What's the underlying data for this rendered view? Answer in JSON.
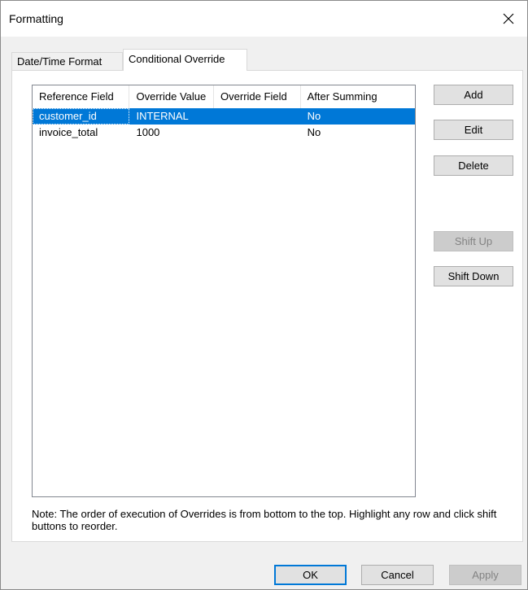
{
  "window": {
    "title": "Formatting"
  },
  "tabs": [
    {
      "label": "Date/Time Format",
      "active": false
    },
    {
      "label": "Conditional Override",
      "active": true
    }
  ],
  "table": {
    "columns": [
      "Reference Field",
      "Override Value",
      "Override Field",
      "After Summing"
    ],
    "rows": [
      {
        "reference_field": "customer_id",
        "override_value": "INTERNAL",
        "override_field": "",
        "after_summing": "No",
        "selected": true
      },
      {
        "reference_field": "invoice_total",
        "override_value": "1000",
        "override_field": "",
        "after_summing": "No",
        "selected": false
      }
    ]
  },
  "buttons": {
    "add": "Add",
    "edit": "Edit",
    "delete": "Delete",
    "shift_up": "Shift Up",
    "shift_down": "Shift Down"
  },
  "note": "Note: The order of execution of Overrides is from bottom to the top. Highlight any row and click shift buttons to reorder.",
  "footer": {
    "ok": "OK",
    "cancel": "Cancel",
    "apply": "Apply"
  },
  "icons": {
    "close": "close-icon"
  },
  "colors": {
    "selection": "#0078d7",
    "default_button_border": "#0078d7"
  }
}
